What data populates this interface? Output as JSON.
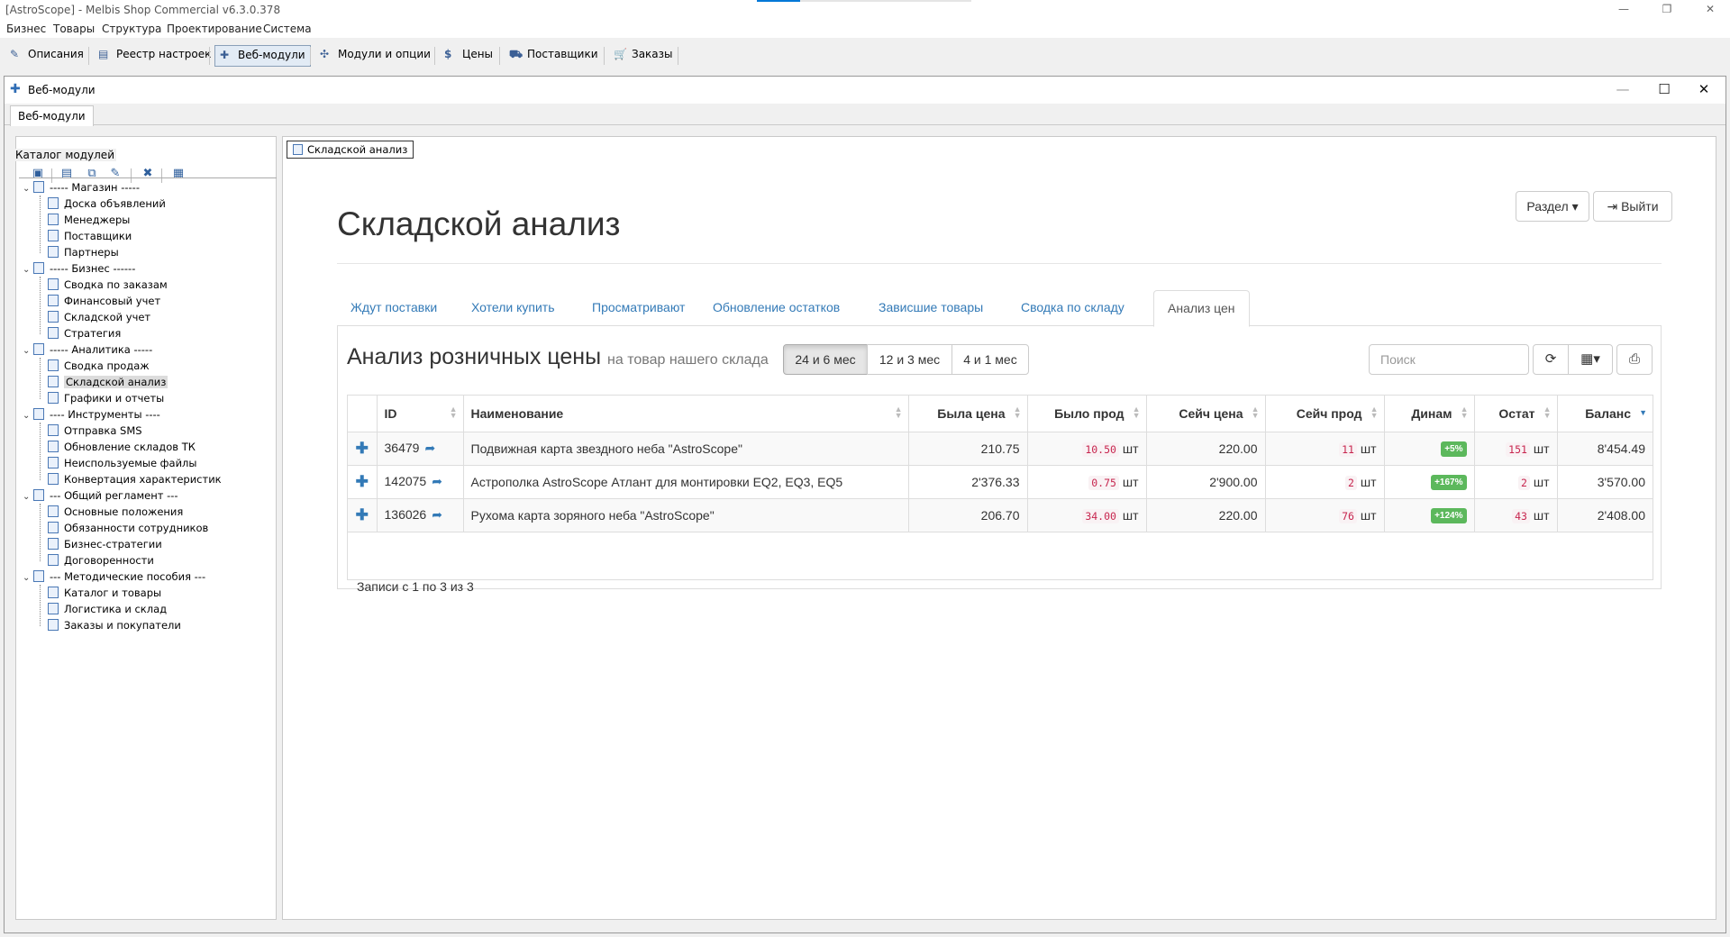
{
  "app": {
    "title": "[AstroScope] - Melbis Shop Commercial v6.3.0.378",
    "window_controls": [
      "—",
      "❐",
      "✕"
    ]
  },
  "menu": [
    "Бизнес",
    "Товары",
    "Структура",
    "Проектирование",
    "Система"
  ],
  "toolbar": {
    "items": [
      {
        "label": "Описания",
        "icon": "edit-icon"
      },
      {
        "label": "Реестр настроек",
        "icon": "registry-icon"
      },
      {
        "label": "Веб-модули",
        "icon": "puzzle-icon"
      },
      {
        "label": "Модули и опции",
        "icon": "modules-icon"
      },
      {
        "label": "Цены",
        "icon": "dollar-icon"
      },
      {
        "label": "Поставщики",
        "icon": "truck-icon"
      },
      {
        "label": "Заказы",
        "icon": "cart-icon"
      }
    ]
  },
  "child_window": {
    "title": "Веб-модули",
    "tab": "Веб-модули",
    "controls": [
      "—",
      "☐",
      "✕"
    ]
  },
  "catalog": {
    "label": "Каталог модулей",
    "tree": [
      {
        "label": "----- Магазин -----",
        "level": 0
      },
      {
        "label": "Доска объявлений",
        "level": 1
      },
      {
        "label": "Менеджеры",
        "level": 1
      },
      {
        "label": "Поставщики",
        "level": 1
      },
      {
        "label": "Партнеры",
        "level": 1
      },
      {
        "label": "----- Бизнес ------",
        "level": 0
      },
      {
        "label": "Сводка по заказам",
        "level": 1
      },
      {
        "label": "Финансовый учет",
        "level": 1
      },
      {
        "label": "Складской учет",
        "level": 1
      },
      {
        "label": "Стратегия",
        "level": 1
      },
      {
        "label": "----- Аналитика -----",
        "level": 0
      },
      {
        "label": "Сводка продаж",
        "level": 1
      },
      {
        "label": "Складской анализ",
        "level": 1,
        "selected": true
      },
      {
        "label": "Графики и отчеты",
        "level": 1
      },
      {
        "label": "---- Инструменты ----",
        "level": 0
      },
      {
        "label": "Отправка SMS",
        "level": 1
      },
      {
        "label": "Обновление складов ТК",
        "level": 1
      },
      {
        "label": "Неиспользуемые файлы",
        "level": 1
      },
      {
        "label": "Конвертация характеристик",
        "level": 1
      },
      {
        "label": "--- Общий регламент ---",
        "level": 0
      },
      {
        "label": "Основные положения",
        "level": 1
      },
      {
        "label": "Обязанности сотрудников",
        "level": 1
      },
      {
        "label": "Бизнес-стратегии",
        "level": 1
      },
      {
        "label": "Договоренности",
        "level": 1
      },
      {
        "label": "--- Методические пособия ---",
        "level": 0
      },
      {
        "label": "Каталог и товары",
        "level": 1
      },
      {
        "label": "Логистика и склад",
        "level": 1
      },
      {
        "label": "Заказы и покупатели",
        "level": 1
      }
    ]
  },
  "inner_tab": "Складской анализ",
  "page": {
    "title": "Складской анализ",
    "section_button": "Раздел",
    "exit_button": "Выйти",
    "tabs": [
      "Ждут поставки",
      "Хотели купить",
      "Просматривают",
      "Обновление остатков",
      "Зависшие товары",
      "Сводка по складу",
      "Анализ цен"
    ],
    "active_tab": "Анализ цен",
    "panel_title": "Анализ розничных цены",
    "panel_subtitle": "на товар нашего склада",
    "periods": [
      "24 и 6 мес",
      "12 и 3 мес",
      "4 и 1 мес"
    ],
    "active_period": "24 и 6 мес",
    "search_placeholder": "Поиск",
    "columns": [
      "ID",
      "Наименование",
      "Была цена",
      "Было прод",
      "Сейч цена",
      "Сейч прод",
      "Динам",
      "Остат",
      "Баланс"
    ],
    "unit": "шт",
    "rows": [
      {
        "id": "36479",
        "name": "Подвижная карта звездного неба \"AstroScope\"",
        "old_price": "210.75",
        "old_sold": "10.50",
        "new_price": "220.00",
        "new_sold": "11",
        "dynamic": "+5%",
        "stock": "151",
        "balance": "8'454.49"
      },
      {
        "id": "142075",
        "name": "Астрополка AstroScope Атлант для монтировки EQ2, EQ3, EQ5",
        "old_price": "2'376.33",
        "old_sold": "0.75",
        "new_price": "2'900.00",
        "new_sold": "2",
        "dynamic": "+167%",
        "stock": "2",
        "balance": "3'570.00"
      },
      {
        "id": "136026",
        "name": "Рухома карта зоряного неба \"AstroScope\"",
        "old_price": "206.70",
        "old_sold": "34.00",
        "new_price": "220.00",
        "new_sold": "76",
        "dynamic": "+124%",
        "stock": "43",
        "balance": "2'408.00"
      }
    ],
    "records_info": "Записи с 1 по 3 из 3"
  },
  "colors": {
    "accent": "#337ab7",
    "success": "#5cb85c",
    "code": "#c7254e"
  }
}
